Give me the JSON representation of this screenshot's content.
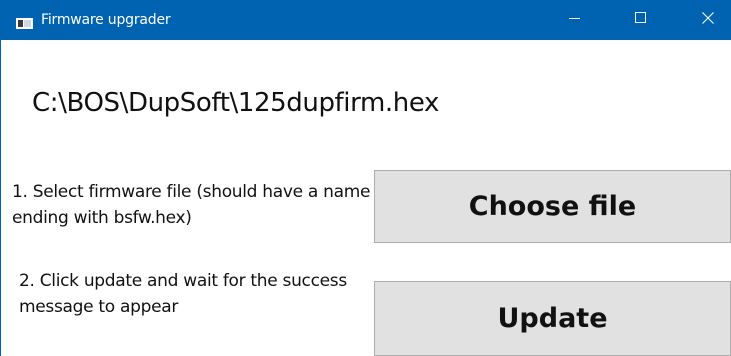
{
  "window": {
    "title": "Firmware upgrader",
    "icon": "app-window-icon",
    "controls": {
      "minimize_icon": "minimize-icon",
      "maximize_icon": "maximize-icon",
      "close_icon": "close-icon"
    },
    "titlebar_color": "#0063b1"
  },
  "main": {
    "file_path": "C:\\BOS\\DupSoft\\125dupfirm.hex",
    "step1_text": "1. Select firmware file (should have a name ending with bsfw.hex)",
    "step2_text": "2. Click update and wait for the success message to appear",
    "choose_file_label": "Choose file",
    "update_label": "Update"
  }
}
